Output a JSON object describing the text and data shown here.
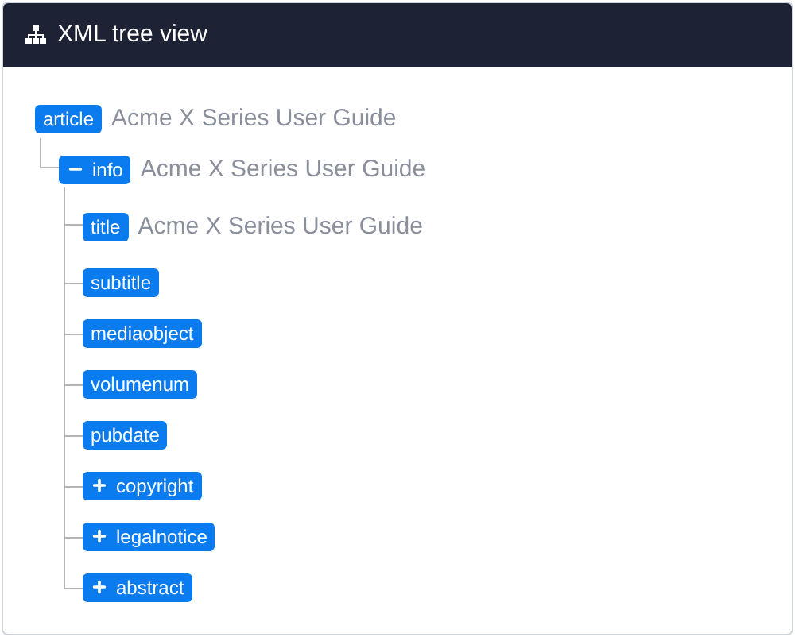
{
  "header": {
    "title": "XML tree view"
  },
  "tree": [
    {
      "tag": "article",
      "text": "Acme X Series User Guide",
      "children": [
        {
          "tag": "info",
          "text": "Acme X Series User Guide",
          "expanded": true,
          "children": [
            {
              "tag": "title",
              "text": "Acme X Series User Guide"
            },
            {
              "tag": "subtitle"
            },
            {
              "tag": "mediaobject"
            },
            {
              "tag": "volumenum"
            },
            {
              "tag": "pubdate"
            },
            {
              "tag": "copyright",
              "expanded": false
            },
            {
              "tag": "legalnotice",
              "expanded": false
            },
            {
              "tag": "abstract",
              "expanded": false
            }
          ]
        }
      ]
    }
  ]
}
